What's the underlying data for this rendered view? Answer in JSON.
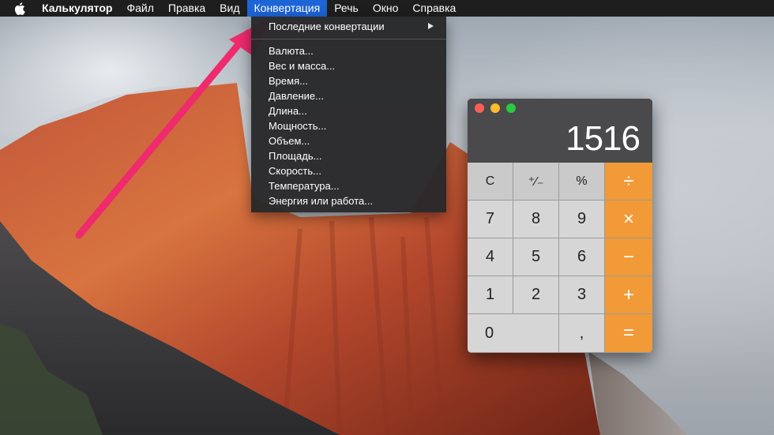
{
  "menubar": {
    "apple_icon": "apple-logo-icon",
    "items": [
      {
        "label": "Калькулятор",
        "bold": true
      },
      {
        "label": "Файл"
      },
      {
        "label": "Правка"
      },
      {
        "label": "Вид"
      },
      {
        "label": "Конвертация",
        "active": true
      },
      {
        "label": "Речь"
      },
      {
        "label": "Окно"
      },
      {
        "label": "Справка"
      }
    ],
    "active_color": "#1d64d6"
  },
  "conversion_menu": {
    "recent": {
      "label": "Последние конвертации",
      "submenu_icon": "submenu-arrow-icon"
    },
    "items": [
      "Валюта...",
      "Вес и масса...",
      "Время...",
      "Давление...",
      "Длина...",
      "Мощность...",
      "Объем...",
      "Площадь...",
      "Скорость...",
      "Температура...",
      "Энергия или работа..."
    ]
  },
  "annotation": {
    "icon": "pointer-arrow-icon",
    "color": "#ef2a6d"
  },
  "calculator": {
    "window_controls": {
      "close_color": "#fc5f57",
      "minimize_color": "#fdbb2e",
      "zoom_color": "#2ac940"
    },
    "display": "1516",
    "keys": [
      [
        "C",
        "⁺∕₋",
        "%",
        "÷"
      ],
      [
        "7",
        "8",
        "9",
        "×"
      ],
      [
        "4",
        "5",
        "6",
        "−"
      ],
      [
        "1",
        "2",
        "3",
        "+"
      ],
      [
        "0",
        ",",
        "="
      ]
    ],
    "operator_color": "#f19a37"
  }
}
